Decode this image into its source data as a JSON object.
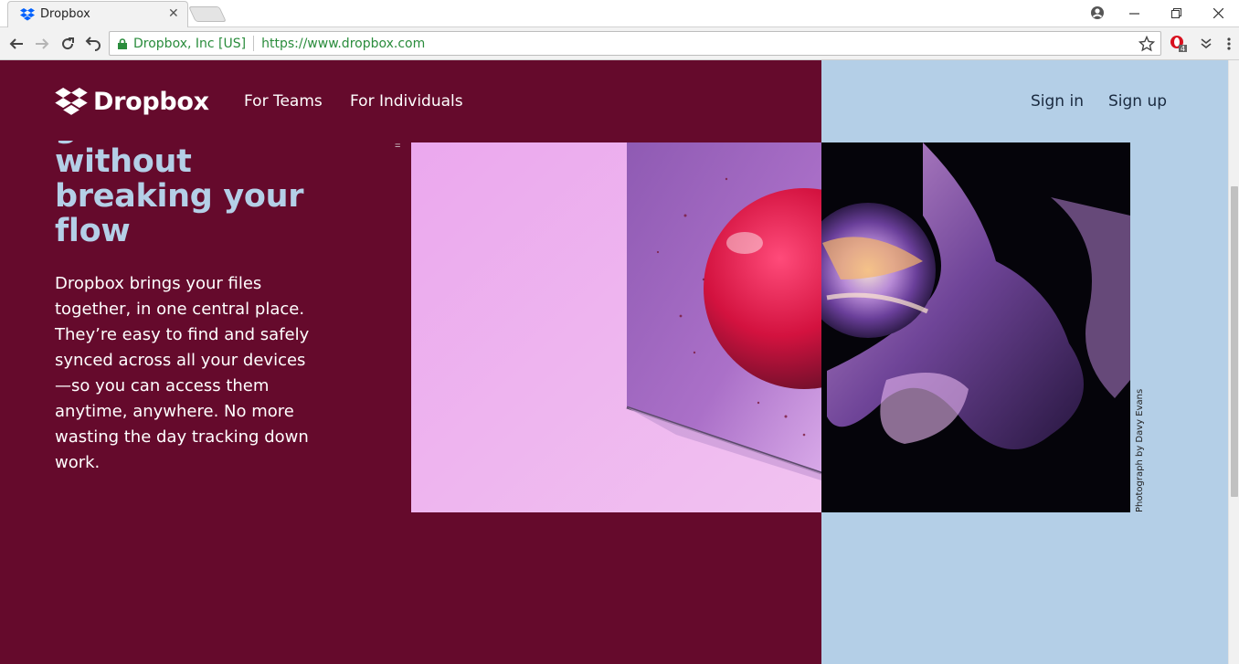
{
  "browser": {
    "tab_title": "Dropbox",
    "site_identity": "Dropbox, Inc [US]",
    "url": "https://www.dropbox.com",
    "extension_badge": "4"
  },
  "header": {
    "brand": "Dropbox",
    "nav": {
      "for_teams": "For Teams",
      "for_individuals": "For Individuals",
      "sign_in": "Sign in",
      "sign_up": "Sign up"
    }
  },
  "hero": {
    "headline_lines": [
      "g",
      "without",
      "breaking your",
      "flow"
    ],
    "body": "Dropbox brings your files together, in one central place. They’re easy to find and safely synced across all your devices—so you can access them anytime, anywhere. No more wasting the day tracking down work.",
    "photo_credit": "Photograph by Davy Evans",
    "mark": "="
  },
  "colors": {
    "left_panel": "#650a2c",
    "right_panel": "#b4cfe7",
    "headline": "#b4cfe7",
    "secure_green": "#2a8c3c"
  }
}
